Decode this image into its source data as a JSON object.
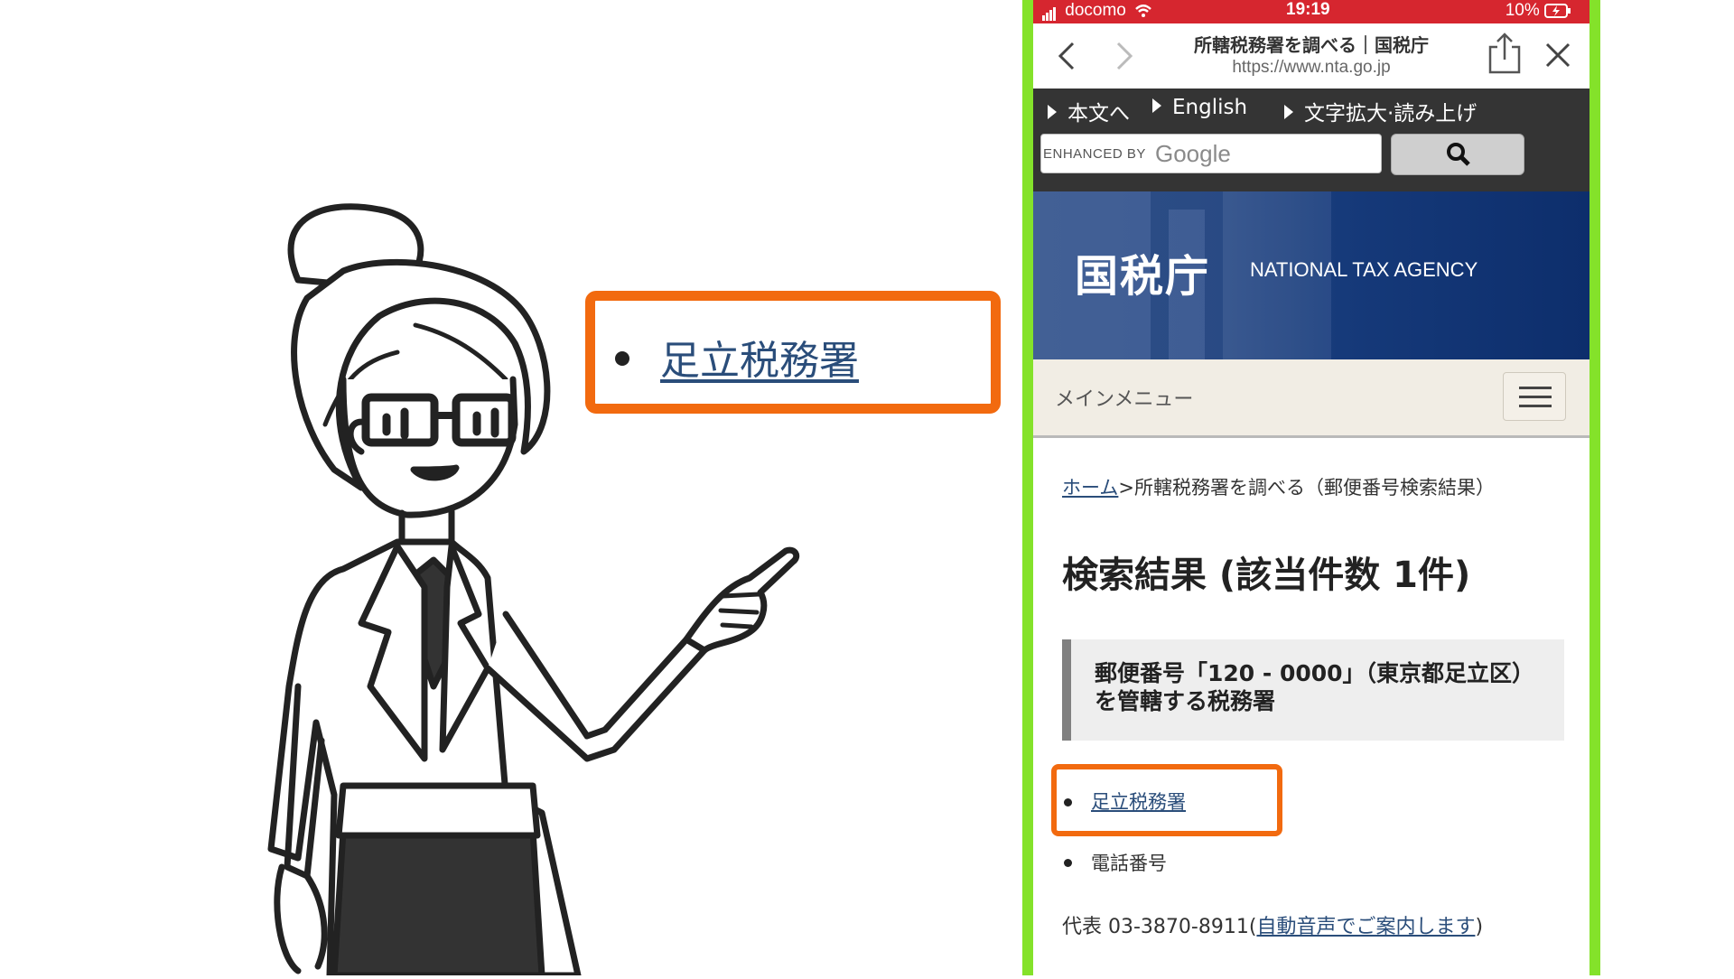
{
  "callout": {
    "link_text": "足立税務署"
  },
  "status_bar": {
    "carrier": "docomo",
    "time": "19:19",
    "battery": "10%"
  },
  "browser": {
    "title": "所轄税務署を調べる｜国税庁",
    "url": "https://www.nta.go.jp"
  },
  "top_links": [
    "本文へ",
    "English",
    "文字拡大·読み上げ"
  ],
  "search": {
    "enhanced_by": "ENHANCED BY",
    "google": "Google"
  },
  "banner": {
    "logo": "国税庁",
    "english": "NATIONAL TAX AGENCY"
  },
  "main_menu": {
    "label": "メインメニュー"
  },
  "breadcrumb": {
    "home": "ホーム",
    "rest": ">所轄税務署を調べる（郵便番号検索結果）"
  },
  "result": {
    "heading": "検索結果 (該当件数 1件)",
    "box_line1": "郵便番号「120 - 0000」（東京都足立区）",
    "box_line2": "を管轄する税務署",
    "office_link": "足立税務署",
    "phone_label": "電話番号",
    "phone_prefix": "代表 03-3870-8911(",
    "phone_link": "自動音声でご案内します",
    "phone_suffix": ")"
  },
  "colors": {
    "highlight": "#f26a0f",
    "frame": "#84e22a",
    "status": "#d6262f",
    "link": "#2a4d7a"
  },
  "icons": [
    "back-icon",
    "forward-icon",
    "share-icon",
    "close-icon",
    "search-icon",
    "hamburger-icon",
    "wifi-icon",
    "signal-icon"
  ]
}
